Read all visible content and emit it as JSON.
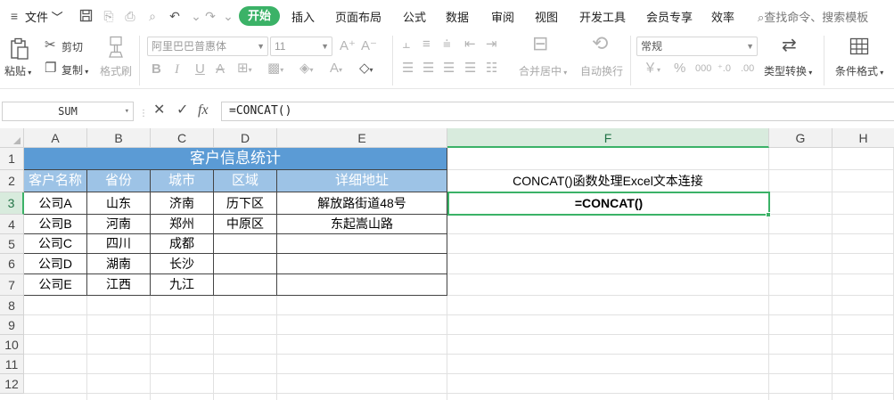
{
  "menubar": {
    "file": "文件",
    "tabs": [
      "开始",
      "插入",
      "页面布局",
      "公式",
      "数据",
      "审阅",
      "视图",
      "开发工具",
      "会员专享",
      "效率"
    ],
    "active_tab": "开始",
    "search": "查找命令、搜索模板"
  },
  "ribbon": {
    "paste": "粘贴",
    "cut": "剪切",
    "copy": "复制",
    "format_painter": "格式刷",
    "font_name": "阿里巴巴普惠体",
    "font_size": "11",
    "merge_center": "合并居中",
    "wrap_text": "自动换行",
    "number_format": "常规",
    "type_convert": "类型转换",
    "conditional_format": "条件格式"
  },
  "formula_bar": {
    "name_box": "SUM",
    "formula": "=CONCAT()"
  },
  "grid": {
    "columns": [
      "A",
      "B",
      "C",
      "D",
      "E",
      "F",
      "G",
      "H"
    ],
    "rows": [
      "1",
      "2",
      "3",
      "4",
      "5",
      "6",
      "7",
      "8",
      "9",
      "10",
      "11",
      "12"
    ],
    "selected_column": "F",
    "selected_row": "3"
  },
  "sheet": {
    "title": "客户信息统计",
    "headers": [
      "客户名称",
      "省份",
      "城市",
      "区域",
      "详细地址"
    ],
    "data": [
      [
        "公司A",
        "山东",
        "济南",
        "历下区",
        "解放路街道48号"
      ],
      [
        "公司B",
        "河南",
        "郑州",
        "中原区",
        "东起嵩山路"
      ],
      [
        "公司C",
        "四川",
        "成都",
        "",
        ""
      ],
      [
        "公司D",
        "湖南",
        "长沙",
        "",
        ""
      ],
      [
        "公司E",
        "江西",
        "九江",
        "",
        ""
      ]
    ],
    "f2": "CONCAT()函数处理Excel文本连接",
    "f3": "=CONCAT()"
  }
}
